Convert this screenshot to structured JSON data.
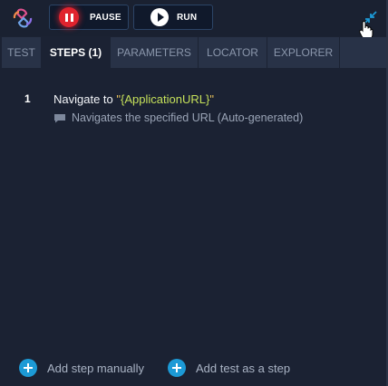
{
  "toolbar": {
    "pause_label": "PAUSE",
    "run_label": "RUN"
  },
  "tabs": [
    {
      "label": "TEST",
      "active": false
    },
    {
      "label": "STEPS (1)",
      "active": true
    },
    {
      "label": "PARAMETERS",
      "active": false
    },
    {
      "label": "LOCATOR",
      "active": false
    },
    {
      "label": "EXPLORER",
      "active": false
    }
  ],
  "steps": [
    {
      "number": "1",
      "action": "Navigate to",
      "open_quote": "\"",
      "param": "{ApplicationURL}",
      "close_quote": "\"",
      "description": "Navigates the specified URL (Auto-generated)"
    }
  ],
  "footer": {
    "add_step_label": "Add step manually",
    "add_test_label": "Add test as a step"
  },
  "colors": {
    "background": "#1b2233",
    "tab_bar": "#283247",
    "pause_red": "#e0232e",
    "accent_blue": "#1c9ad6",
    "param_green": "#c5e05a"
  },
  "icons": [
    "logo-icon",
    "pause-icon",
    "play-icon",
    "collapse-icon",
    "cursor-icon",
    "comment-icon",
    "plus-icon"
  ]
}
